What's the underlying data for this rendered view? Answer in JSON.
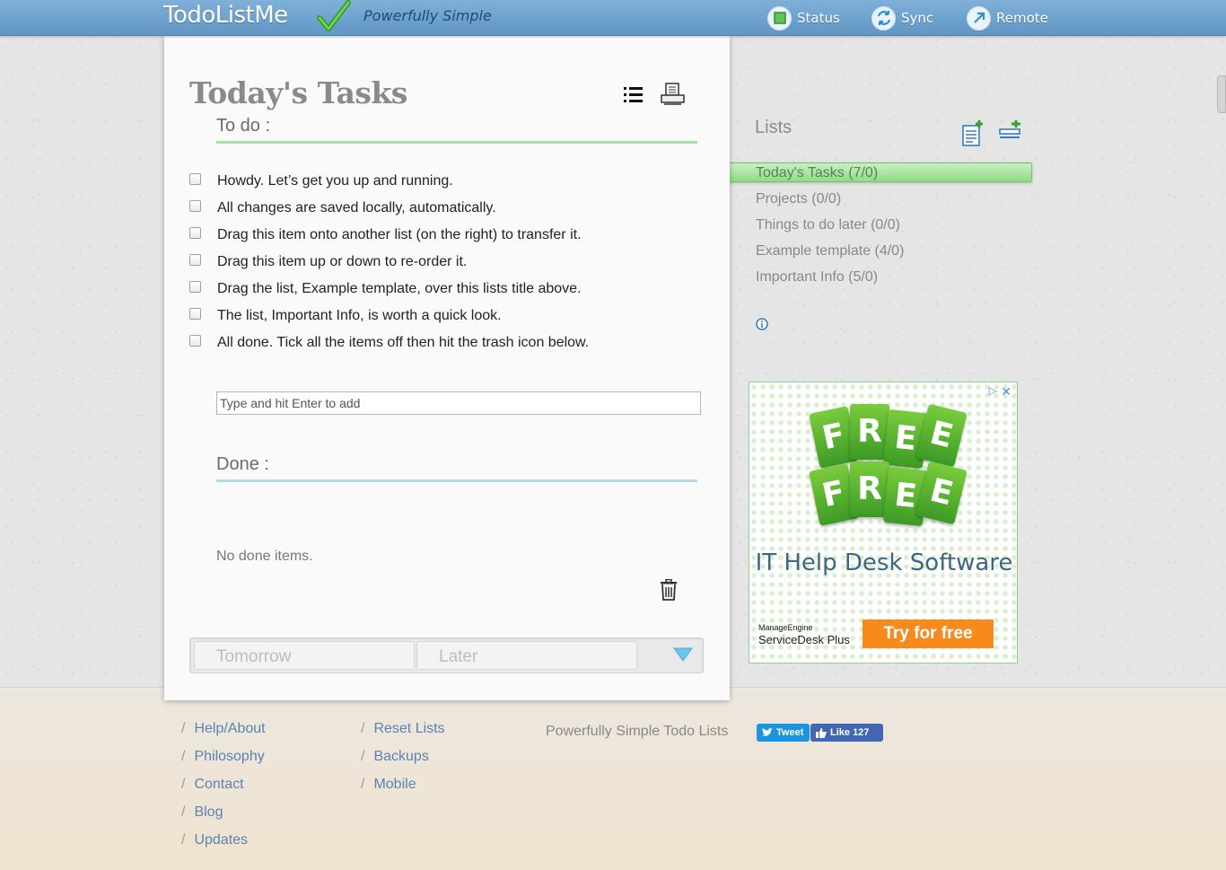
{
  "header": {
    "logo": "TodoListMe",
    "tagline": "Powerfully Simple",
    "nav": [
      {
        "label": "Status",
        "icon": "status-icon"
      },
      {
        "label": "Sync",
        "icon": "sync-icon"
      },
      {
        "label": "Remote",
        "icon": "remote-icon"
      }
    ]
  },
  "list_panel": {
    "title": "Today's Tasks",
    "todo_heading": "To do :",
    "tasks": [
      "Howdy. Let’s get you up and running.",
      "All changes are saved locally, automatically.",
      "Drag this item onto another list (on the right) to transfer it.",
      "Drag this item up or down to re-order it.",
      "Drag the list, Example template, over this lists title above.",
      "The list, Important Info, is worth a quick look.",
      "All done. Tick all the items off then hit the trash icon below."
    ],
    "add_placeholder": "Type and hit Enter to add",
    "done_heading": "Done :",
    "no_done": "No done items.",
    "tabs": [
      "Tomorrow",
      "Later"
    ]
  },
  "sidebar": {
    "title": "Lists",
    "lists": [
      "Today's Tasks (7/0)",
      "Projects (0/0)",
      "Things to do later (0/0)",
      "Example template (4/0)",
      "Important Info (5/0)"
    ]
  },
  "ad": {
    "tag_letters": [
      "F",
      "R",
      "E",
      "E"
    ],
    "headline": "IT Help Desk Software",
    "brand_small": "ManageEngine",
    "brand": "ServiceDesk Plus",
    "cta": "Try for free",
    "close": "✕",
    "badge": "▷"
  },
  "footer": {
    "col1": [
      "Help/About",
      "Philosophy",
      "Contact",
      "Blog",
      "Updates"
    ],
    "col2": [
      "Reset Lists",
      "Backups",
      "Mobile"
    ],
    "tagline": "Powerfully Simple Todo Lists",
    "tweet": "Tweet",
    "like": "Like 127"
  },
  "colors": {
    "topbar": "#6fa3cf",
    "todo_rule": "#a8dfa5",
    "done_rule": "#b6d6ea",
    "active_list": "#a5e29d",
    "footer_link": "#5a83b0",
    "cta": "#f78a1d"
  }
}
